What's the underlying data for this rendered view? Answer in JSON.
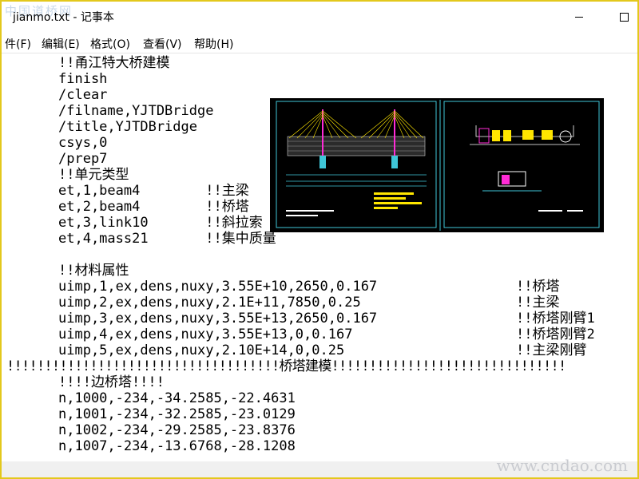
{
  "window": {
    "title": "jianmo.txt - 记事本",
    "watermark_top": "中国道桥网",
    "watermark_bottom": "www.cndao.com",
    "accent_border": "#e3c81c"
  },
  "menu": [
    {
      "label": "件(F)"
    },
    {
      "label": "编辑(E)"
    },
    {
      "label": "格式(O)"
    },
    {
      "label": "查看(V)"
    },
    {
      "label": "帮助(H)"
    }
  ],
  "content": {
    "lines": [
      "!!甬江特大桥建模",
      "finish",
      "/clear",
      "/filname,YJTDBridge",
      "/title,YJTDBridge",
      "csys,0",
      "/prep7",
      "!!单元类型",
      "et,1,beam4        !!主梁",
      "et,2,beam4        !!桥塔",
      "et,3,link10       !!斜拉索",
      "et,4,mass21       !!集中质量",
      "",
      "!!材料属性",
      "uimp,1,ex,dens,nuxy,3.55E+10,2650,0.167",
      "uimp,2,ex,dens,nuxy,2.1E+11,7850,0.25",
      "uimp,3,ex,dens,nuxy,3.55E+13,2650,0.167",
      "uimp,4,ex,dens,nuxy,3.55E+13,0,0.167",
      "uimp,5,ex,dens,nuxy,2.10E+14,0,0.25"
    ],
    "material_comments": [
      "!!桥塔",
      "!!主梁",
      "!!桥塔刚臂1",
      "!!桥塔刚臂2",
      "!!主梁刚臂"
    ],
    "separator": "!!!!!!!!!!!!!!!!!!!!!!!!!!!!!!!!!!!!桥塔建模!!!!!!!!!!!!!!!!!!!!!!!!!!!!!!!",
    "lines2": [
      "!!!!边桥塔!!!!",
      "n,1000,-234,-34.2585,-22.4631",
      "n,1001,-234,-32.2585,-23.0129",
      "n,1002,-234,-29.2585,-23.8376",
      "n,1007,-234,-13.6768,-28.1208"
    ]
  },
  "cad_image": {
    "background": "#000000",
    "accent_colors": [
      "#4fd0e0",
      "#ffe600",
      "#ff2bd6",
      "#ffffff"
    ]
  }
}
